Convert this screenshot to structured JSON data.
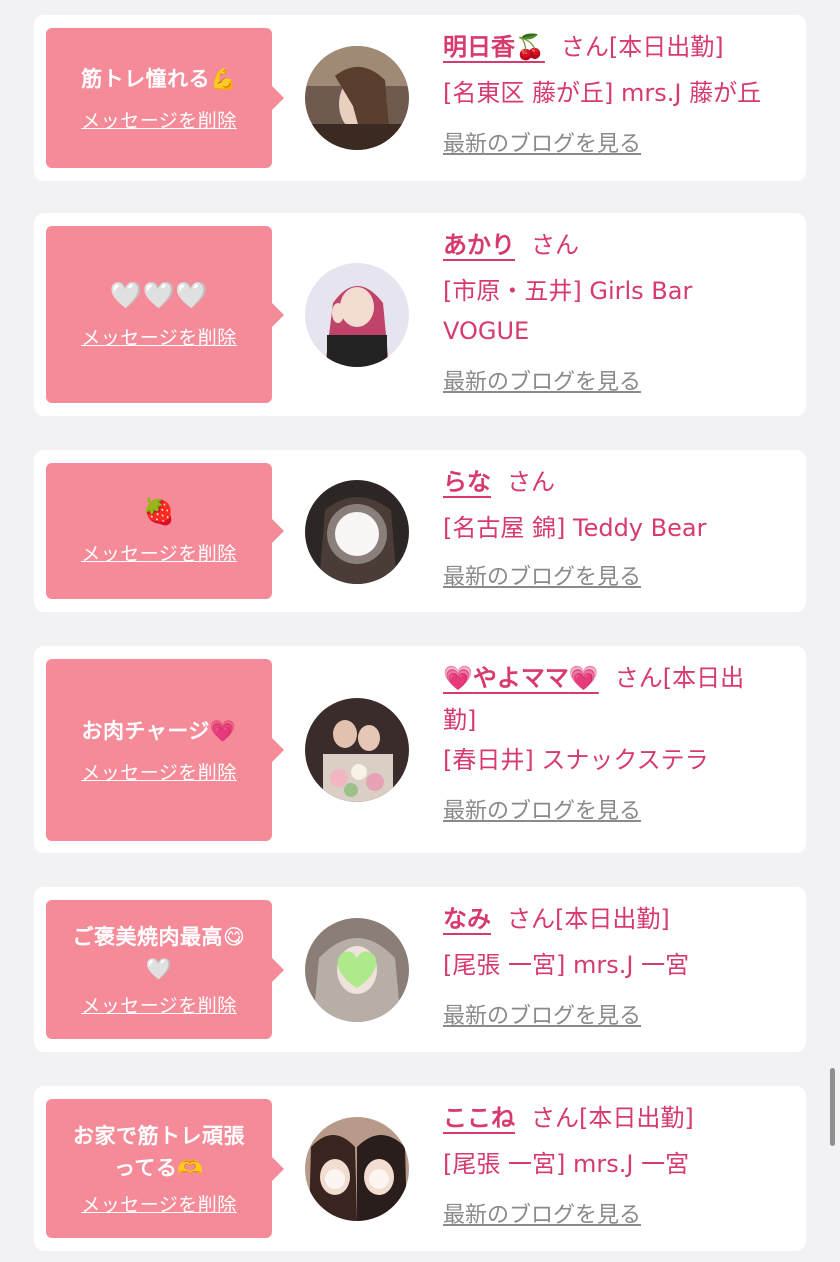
{
  "cards": [
    {
      "message_text": "筋トレ憧れる",
      "message_emoji": "💪",
      "delete_label": "メッセージを削除",
      "name": "明日香",
      "name_emoji": "🍒",
      "san": "さん",
      "status": "[本日出勤]",
      "location": "[名東区 藤が丘] mrs.J 藤が丘",
      "blog_label": "最新のブログを見る"
    },
    {
      "message_text": "🤍🤍🤍",
      "delete_label": "メッセージを削除",
      "name": "あかり",
      "san": "さん",
      "location_line1": "[市原・五井] Girls Bar",
      "location_line2": "VOGUE",
      "blog_label": "最新のブログを見る"
    },
    {
      "message_text": "🍓",
      "delete_label": "メッセージを削除",
      "name": "らな",
      "san": "さん",
      "location": "[名古屋 錦] Teddy Bear",
      "blog_label": "最新のブログを見る"
    },
    {
      "message_text": "お肉チャージ",
      "message_emoji": "💗",
      "delete_label": "メッセージを削除",
      "name": "やよママ",
      "name_emoji": "💗",
      "san": "さん",
      "status_part1": "[本日出",
      "status_part2": "勤]",
      "location": "[春日井] スナックステラ",
      "blog_label": "最新のブログを見る"
    },
    {
      "message_text": "ご褒美焼肉最高",
      "message_emoji": "😋",
      "message_line2": "🤍",
      "delete_label": "メッセージを削除",
      "name": "なみ",
      "san": "さん",
      "status": "[本日出勤]",
      "location": "[尾張 一宮] mrs.J 一宮",
      "blog_label": "最新のブログを見る"
    },
    {
      "message_text": "お家で筋トレ頑張",
      "message_line2": "ってる",
      "message_emoji": "🫶",
      "delete_label": "メッセージを削除",
      "name": "ここね",
      "san": "さん",
      "status": "[本日出勤]",
      "location": "[尾張 一宮] mrs.J 一宮",
      "blog_label": "最新のブログを見る"
    }
  ],
  "colors": {
    "page_bg": "#f2f2f4",
    "bubble_bg": "#f58b98",
    "accent_pink": "#d73a6c",
    "link_gray": "#8a8a8a"
  }
}
